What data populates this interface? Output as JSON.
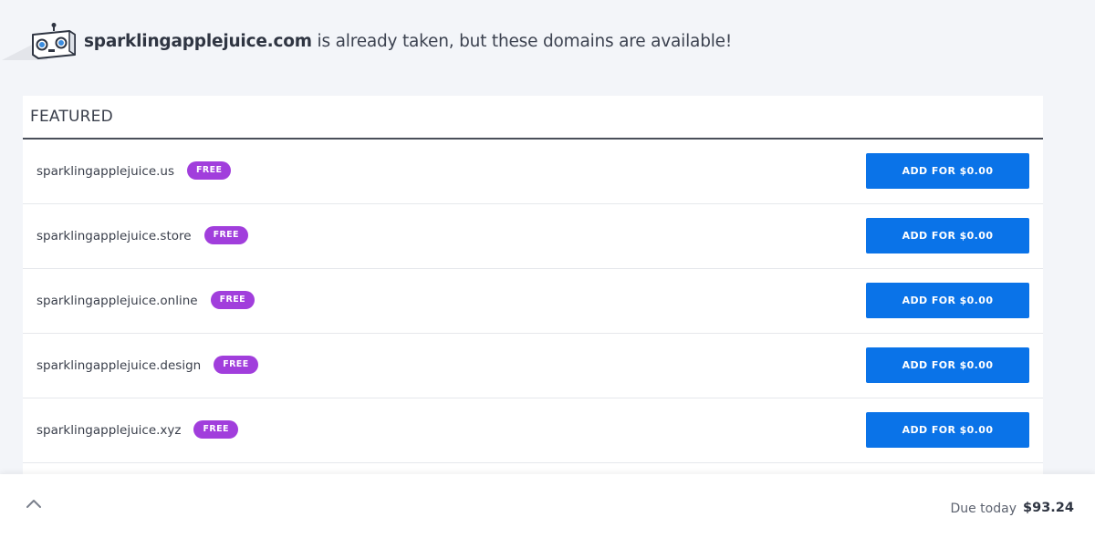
{
  "header": {
    "taken_domain": "sparklingapplejuice.com",
    "message": " is already taken, but these domains are available!",
    "mascot_icon": "robot-mascot-icon"
  },
  "featured": {
    "title": "FEATURED",
    "rows": [
      {
        "domain": "sparklingapplejuice.us",
        "badge": "FREE",
        "button": "ADD FOR $0.00"
      },
      {
        "domain": "sparklingapplejuice.store",
        "badge": "FREE",
        "button": "ADD FOR $0.00"
      },
      {
        "domain": "sparklingapplejuice.online",
        "badge": "FREE",
        "button": "ADD FOR $0.00"
      },
      {
        "domain": "sparklingapplejuice.design",
        "badge": "FREE",
        "button": "ADD FOR $0.00"
      },
      {
        "domain": "sparklingapplejuice.xyz",
        "badge": "FREE",
        "button": "ADD FOR $0.00"
      }
    ]
  },
  "footer": {
    "expand_icon": "chevron-up-icon",
    "due_label": "Due today",
    "due_amount": "$93.24"
  },
  "colors": {
    "page_bg": "#f3f5f9",
    "button": "#0a73e8",
    "badge": "#a13edc",
    "text": "#3a3f4b"
  }
}
